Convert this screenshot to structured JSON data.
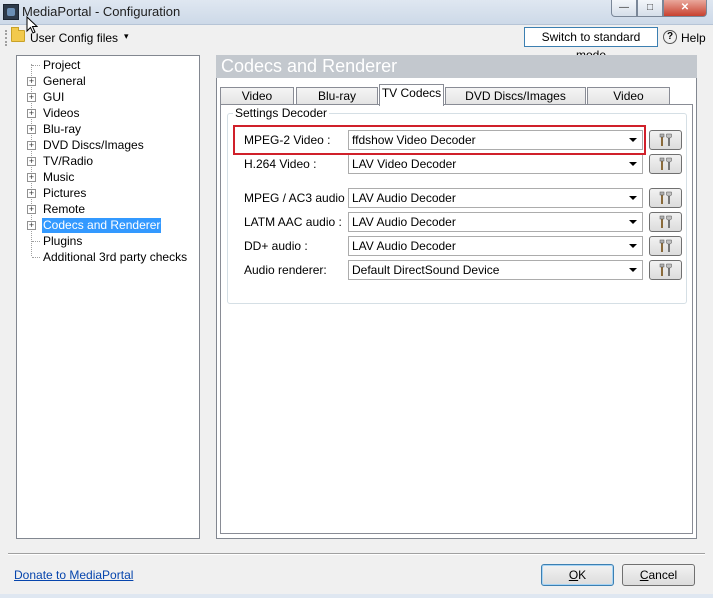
{
  "window": {
    "title": "MediaPortal - Configuration"
  },
  "toolbar": {
    "config_label": "User Config files",
    "caret": "▾",
    "switch_label": "Switch to standard mode",
    "help_label": "Help",
    "help_glyph": "?"
  },
  "tree": {
    "items": [
      {
        "label": "Project",
        "expandable": false
      },
      {
        "label": "General",
        "expandable": true
      },
      {
        "label": "GUI",
        "expandable": true
      },
      {
        "label": "Videos",
        "expandable": true
      },
      {
        "label": "Blu-ray",
        "expandable": true
      },
      {
        "label": "DVD Discs/Images",
        "expandable": true
      },
      {
        "label": "TV/Radio",
        "expandable": true
      },
      {
        "label": "Music",
        "expandable": true
      },
      {
        "label": "Pictures",
        "expandable": true
      },
      {
        "label": "Remote",
        "expandable": true
      },
      {
        "label": "Codecs and Renderer",
        "expandable": true,
        "selected": true
      },
      {
        "label": "Plugins",
        "expandable": false
      },
      {
        "label": "Additional 3rd party checks",
        "expandable": false
      }
    ],
    "expander_glyph": "+"
  },
  "panel": {
    "header": "Codecs and Renderer",
    "tabs": [
      {
        "label": "Video Codecs"
      },
      {
        "label": "Blu-ray Codecs"
      },
      {
        "label": "TV Codecs",
        "active": true
      },
      {
        "label": "DVD Discs/Images Codecs"
      },
      {
        "label": "Video Renderer"
      }
    ],
    "group_title": "Settings Decoder",
    "rows": [
      {
        "label": "MPEG-2 Video :",
        "value": "ffdshow Video Decoder",
        "highlighted": true
      },
      {
        "label": "H.264 Video :",
        "value": "LAV Video Decoder"
      },
      {
        "label": "MPEG / AC3 audio :",
        "value": "LAV Audio Decoder"
      },
      {
        "label": "LATM AAC audio :",
        "value": "LAV Audio Decoder"
      },
      {
        "label": "DD+ audio :",
        "value": "LAV Audio Decoder"
      },
      {
        "label": "Audio renderer:",
        "value": "Default DirectSound Device"
      }
    ],
    "highlight_color": "#d0202a"
  },
  "footer": {
    "donate_link": "Donate to MediaPortal",
    "ok_label": "OK",
    "cancel_label": "Cancel"
  },
  "window_controls": {
    "minimize": "—",
    "maximize": "□",
    "close": "✕"
  }
}
